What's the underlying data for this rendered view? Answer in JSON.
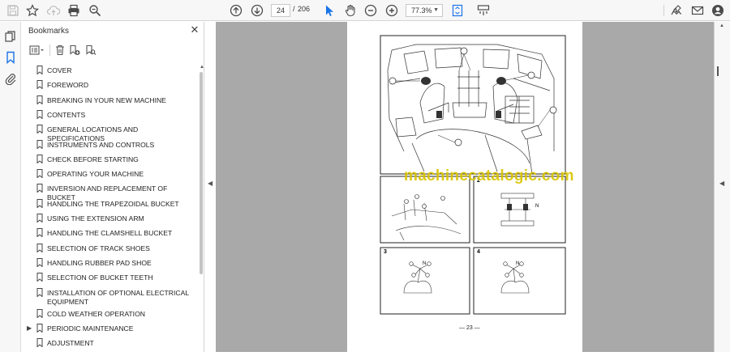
{
  "toolbar": {
    "page_current": "24",
    "page_separator": "/",
    "page_total": "206",
    "zoom": "77.3%"
  },
  "panel": {
    "title": "Bookmarks",
    "close": "✕"
  },
  "bookmarks": [
    {
      "label": "COVER",
      "expandable": false
    },
    {
      "label": "FOREWORD",
      "expandable": false
    },
    {
      "label": "BREAKING IN YOUR NEW MACHINE",
      "expandable": false
    },
    {
      "label": "CONTENTS",
      "expandable": false
    },
    {
      "label": "GENERAL LOCATIONS AND SPECIFICATIONS",
      "expandable": false
    },
    {
      "label": "INSTRUMENTS AND CONTROLS",
      "expandable": false
    },
    {
      "label": "CHECK BEFORE STARTING",
      "expandable": false
    },
    {
      "label": "OPERATING YOUR MACHINE",
      "expandable": false
    },
    {
      "label": "INVERSION AND REPLACEMENT OF BUCKET",
      "expandable": false
    },
    {
      "label": "HANDLING THE TRAPEZOIDAL BUCKET",
      "expandable": false
    },
    {
      "label": "USING THE EXTENSION ARM",
      "expandable": false
    },
    {
      "label": "HANDLING THE CLAMSHELL BUCKET",
      "expandable": false
    },
    {
      "label": "SELECTION OF TRACK SHOES",
      "expandable": false
    },
    {
      "label": "HANDLING RUBBER PAD SHOE",
      "expandable": false
    },
    {
      "label": "SELECTION OF BUCKET TEETH",
      "expandable": false
    },
    {
      "label": "INSTALLATION OF OPTIONAL ELECTRICAL EQUIPMENT",
      "expandable": false
    },
    {
      "label": "COLD WEATHER OPERATION",
      "expandable": false
    },
    {
      "label": "PERIODIC MAINTENANCE",
      "expandable": true
    },
    {
      "label": "ADJUSTMENT",
      "expandable": false
    }
  ],
  "document": {
    "watermark": "machinecatalogic.com",
    "page_footer": "— 23 —",
    "panel_numbers": [
      "2",
      "3",
      "4"
    ],
    "shift_labels": [
      "N",
      "N",
      "N"
    ]
  },
  "icons": {
    "save": "save-icon",
    "bookmark_star": "star-icon",
    "cloud_upload": "cloud-upload-icon",
    "print": "print-icon",
    "zoom_search": "search-zoom-icon",
    "prev_page": "arrow-up-circle-icon",
    "next_page": "arrow-down-circle-icon",
    "select": "cursor-icon",
    "hand": "hand-icon",
    "zoom_out": "zoom-out-icon",
    "zoom_in": "zoom-in-icon",
    "fit": "fit-page-icon",
    "scroll_mode": "scroll-mode-icon",
    "sign": "sign-icon",
    "email": "email-icon",
    "account": "account-icon"
  }
}
